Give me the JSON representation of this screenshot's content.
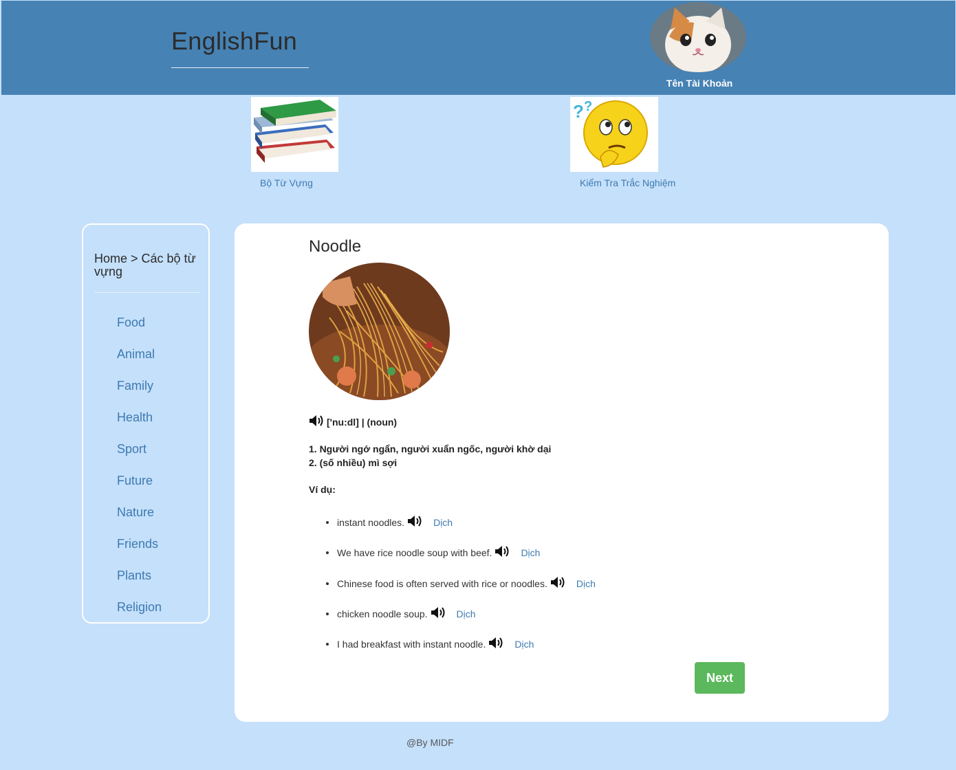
{
  "header": {
    "brand": "EnglishFun",
    "account_name": "Tên Tài Khoản"
  },
  "nav": [
    {
      "label": "Bộ Từ Vựng",
      "icon": "books-icon"
    },
    {
      "label": "Kiểm Tra Trắc Nghiệm",
      "icon": "thinking-face-icon"
    }
  ],
  "sidebar": {
    "breadcrumb": "Home > Các bộ từ vựng",
    "items": [
      "Food",
      "Animal",
      "Family",
      "Health",
      "Sport",
      "Future",
      "Nature",
      "Friends",
      "Plants",
      "Religion"
    ]
  },
  "word": {
    "title": "Noodle",
    "phonetic": "['nu:dl] | (noun)",
    "meanings": [
      "1. Người ngớ ngẩn, người xuẩn ngốc, người khờ dại",
      "2. (số nhiều) mì sợi"
    ],
    "examples_label": "Ví dụ:",
    "examples": [
      "instant noodles.",
      "We have rice noodle soup with beef.",
      "Chinese food is often served with rice or noodles.",
      "chicken noodle soup.",
      "I had breakfast with instant noodle."
    ],
    "translate_label": "Dịch"
  },
  "next_label": "Next",
  "footer": "@By MIDF",
  "colors": {
    "header_bg": "#4682b4",
    "page_bg": "#c5e0fb",
    "link": "#3d7ab0",
    "next_button": "#5cb85c"
  }
}
